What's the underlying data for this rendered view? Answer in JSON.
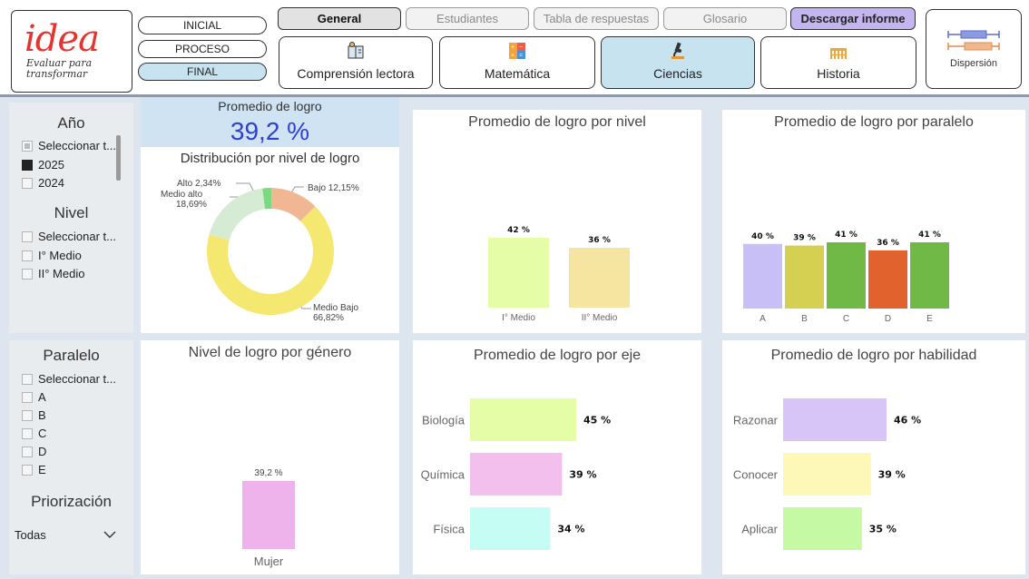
{
  "logo": {
    "word": "idea",
    "tagline": "Evaluar para transformar"
  },
  "stages": [
    "INICIAL",
    "PROCESO",
    "FINAL"
  ],
  "tabs": {
    "general": "General",
    "estudiantes": "Estudiantes",
    "tabla": "Tabla de respuestas",
    "glosario": "Glosario",
    "descargar": "Descargar informe"
  },
  "subjects": [
    "Comprensión lectora",
    "Matemática",
    "Ciencias",
    "Historia"
  ],
  "dispersion_label": "Dispersión",
  "filters": {
    "anio": {
      "title": "Año",
      "options": [
        "Seleccionar t...",
        "2025",
        "2024"
      ]
    },
    "nivel": {
      "title": "Nivel",
      "options": [
        "Seleccionar t...",
        "I° Medio",
        "II° Medio"
      ]
    },
    "paralelo": {
      "title": "Paralelo",
      "options": [
        "Seleccionar t...",
        "A",
        "B",
        "C",
        "D",
        "E"
      ]
    },
    "priorizacion": {
      "title": "Priorización",
      "value": "Todas"
    }
  },
  "kpi": {
    "label": "Promedio de logro",
    "value": "39,2 %"
  },
  "donut": {
    "title": "Distribución por nivel de logro",
    "slices": [
      {
        "name": "Bajo",
        "label": "Bajo 12,15%",
        "value": 12.15,
        "color": "#f1b792"
      },
      {
        "name": "Medio Bajo",
        "label_1": "Medio Bajo",
        "label_2": "66,82%",
        "value": 66.82,
        "color": "#f5e870"
      },
      {
        "name": "Medio alto",
        "label_1": "Medio alto",
        "label_2": "18,69%",
        "value": 18.69,
        "color": "#d6ebd3"
      },
      {
        "name": "Alto",
        "label": "Alto 2,34%",
        "value": 2.34,
        "color": "#7bd97f"
      }
    ]
  },
  "charts": {
    "nivel": {
      "title": "Promedio de logro por nivel",
      "categories": [
        "I° Medio",
        "II° Medio"
      ],
      "labels": [
        "42 %",
        "36 %"
      ],
      "values": [
        42,
        36
      ],
      "colors": [
        "#e5fda6",
        "#f5e5a0"
      ]
    },
    "paralelo": {
      "title": "Promedio de logro por paralelo",
      "categories": [
        "A",
        "B",
        "C",
        "D",
        "E"
      ],
      "labels": [
        "40 %",
        "39 %",
        "41 %",
        "36 %",
        "41 %"
      ],
      "values": [
        40,
        39,
        41,
        36,
        41
      ],
      "colors": [
        "#c9bff7",
        "#d5cf52",
        "#70b946",
        "#e2622e",
        "#70b946"
      ]
    },
    "genero": {
      "title": "Nivel de logro por género",
      "categories": [
        "Mujer"
      ],
      "labels": [
        "39,2 %"
      ],
      "values": [
        39.2
      ],
      "colors": [
        "#efb3eb"
      ]
    },
    "eje": {
      "title": "Promedio de logro por eje",
      "categories": [
        "Biología",
        "Química",
        "Física"
      ],
      "labels": [
        "45 %",
        "39 %",
        "34 %"
      ],
      "values": [
        45,
        39,
        34
      ],
      "colors": [
        "#e5fda6",
        "#f3bfec",
        "#c5fdf5"
      ]
    },
    "habilidad": {
      "title": "Promedio de logro por habilidad",
      "categories": [
        "Razonar",
        "Conocer",
        "Aplicar"
      ],
      "labels": [
        "46 %",
        "39 %",
        "35 %"
      ],
      "values": [
        46,
        39,
        35
      ],
      "colors": [
        "#d7c5f8",
        "#fdf8b8",
        "#c5f9a3"
      ]
    }
  }
}
